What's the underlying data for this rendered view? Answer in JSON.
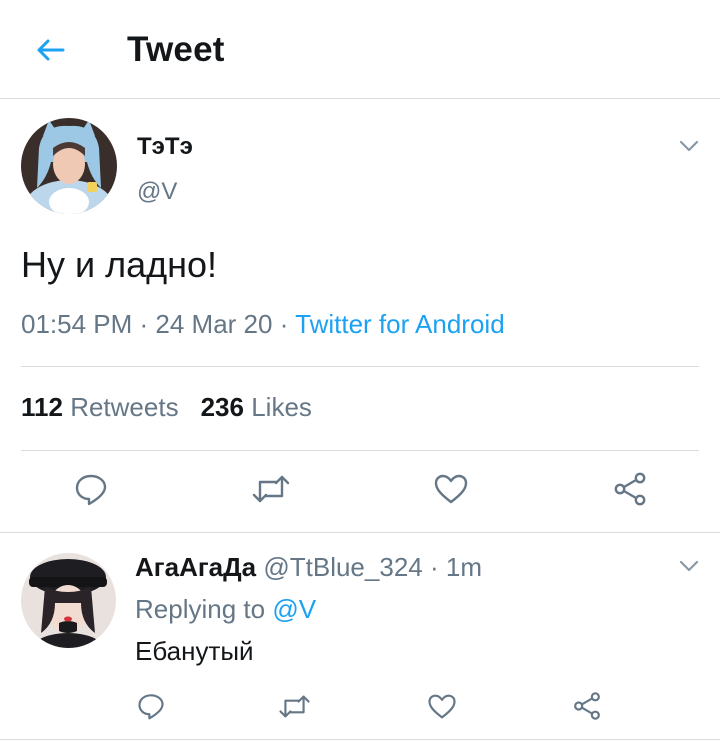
{
  "header": {
    "title": "Tweet",
    "back_icon": "arrow-left-icon"
  },
  "tweet": {
    "author_name": "ТэТэ",
    "author_handle": "@V",
    "text": "Ну и ладно!",
    "time": "01:54 PM",
    "sep1": " · ",
    "date": "24 Mar 20",
    "sep2": " · ",
    "source": "Twitter for Android",
    "retweets_count": "112",
    "retweets_label": "Retweets",
    "likes_count": "236",
    "likes_label": "Likes",
    "actions": [
      "reply-icon",
      "retweet-icon",
      "like-icon",
      "share-icon"
    ]
  },
  "reply": {
    "author_name": "АгаАгаДа",
    "author_handle": "@TtBlue_324",
    "sep": " · ",
    "time": "1m",
    "replying_label": "Replying to",
    "replying_to": "@V",
    "text": "Ебанутый",
    "actions": [
      "reply-icon",
      "retweet-icon",
      "like-icon",
      "share-icon"
    ]
  },
  "colors": {
    "accent": "#1da1f2",
    "text_primary": "#14171a",
    "text_secondary": "#657786",
    "divider": "#d8dde1",
    "icon": "#657786"
  }
}
